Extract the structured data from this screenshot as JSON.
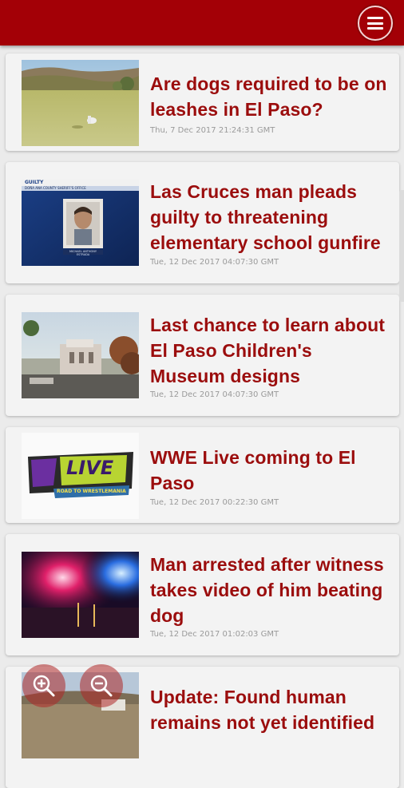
{
  "header": {
    "menu_icon": "hamburger-menu-icon",
    "brand_color": "#a30006"
  },
  "articles": [
    {
      "title": "Are dogs required to be on leashes in El Paso?",
      "date": "Thu, 7 Dec 2017 21:24:31 GMT",
      "image": "dog-in-field-photo"
    },
    {
      "title": "Las Cruces man pleads guilty to threatening elementary school gunfire",
      "date": "Tue, 12 Dec 2017 04:07:30 GMT",
      "image": "mugshot-news-graphic",
      "image_text": {
        "top": "GUILTY",
        "sub": "DOÑA ANA COUNTY SHERIFF'S OFFICE",
        "name": "MICHAEL ANTHONY ESTRADA"
      }
    },
    {
      "title": "Last chance to learn about El Paso Children's Museum designs",
      "date": "Tue, 12 Dec 2017 04:07:30 GMT",
      "image": "museum-rendering-photo"
    },
    {
      "title": "WWE Live coming to El Paso",
      "date": "Tue, 12 Dec 2017 00:22:30 GMT",
      "image": "wwe-live-logo",
      "image_text": {
        "brand": "LIVE",
        "banner": "ROAD TO WRESTLEMANIA"
      }
    },
    {
      "title": "Man arrested after witness takes video of him beating dog",
      "date": "Tue, 12 Dec 2017 01:02:03 GMT",
      "image": "police-lights-photo"
    },
    {
      "title": "Update: Found human remains not yet identified",
      "image": "desert-scene-photo"
    }
  ],
  "zoom": {
    "zoom_in_icon": "zoom-in-icon",
    "zoom_out_icon": "zoom-out-icon"
  }
}
